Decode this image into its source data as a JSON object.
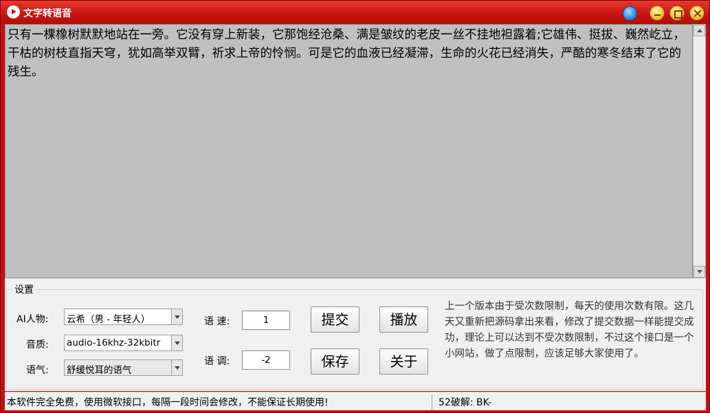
{
  "window": {
    "title": "文字转语音",
    "icons": [
      "play-circle-icon",
      "skin-icon",
      "minimize-icon",
      "maximize-icon",
      "close-icon"
    ],
    "accent_color": "#c41010"
  },
  "editor": {
    "text": "只有一棵橡树默默地站在一旁。它没有穿上新装，它那饱经沧桑、满是皱纹的老皮一丝不挂地袒露着;它雄伟、挺拔、巍然屹立，干枯的树枝直指天穹，犹如高举双臂，祈求上帝的怜悯。可是它的血液已经凝滞，生命的火花已经消失，严酷的寒冬结束了它的残生。"
  },
  "settings": {
    "title": "设置",
    "voice_label": "AI人物:",
    "voice_value": "云希（男 - 年轻人）",
    "quality_label": "音质:",
    "quality_value": "audio-16khz-32kbitr",
    "tone_label": "语气:",
    "tone_value": "舒缓悦耳的语气",
    "speed_label": "语 速:",
    "speed_value": "1",
    "pitch_label": "语 调:",
    "pitch_value": "-2",
    "submit_label": "提交",
    "play_label": "播放",
    "save_label": "保存",
    "about_label": "关于",
    "note": "上一个版本由于受次数限制，每天的使用次数有限。这几天又重新把源码拿出来看，修改了提交数据一样能提交成功，理论上可以达到不受次数限制，不过这个接口是一个小网站，做了点限制，应该足够大家使用了。"
  },
  "status": {
    "left": "本软件完全免费，使用微软接口，每隔一段时间会修改，不能保证长期使用!",
    "right": "52破解: BK-"
  }
}
